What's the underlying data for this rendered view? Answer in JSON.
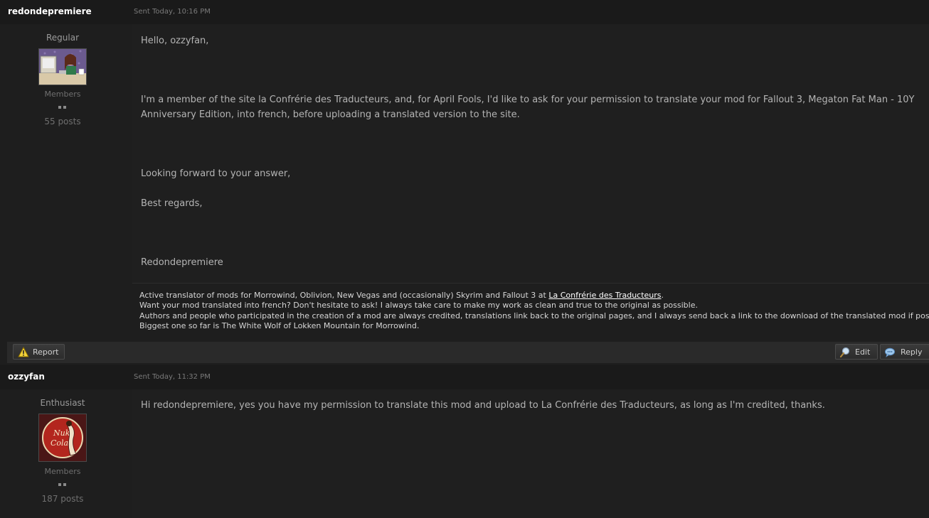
{
  "posts": [
    {
      "author": "redondepremiere",
      "sent": "Sent Today, 10:16 PM",
      "member_title": "Regular",
      "group": "Members",
      "post_count": "55 posts",
      "paragraphs": [
        "Hello, ozzyfan,",
        "I'm a member of the site la Confrérie des Traducteurs, and, for April Fools, I'd like to ask for your permission to translate your mod for Fallout 3, Megaton Fat Man - 10Y",
        "Anniversary Edition, into french, before uploading a translated version to the site.",
        "Looking forward to your answer,",
        "Best regards,",
        "Redondepremiere"
      ],
      "signature": {
        "line1_prefix": "Active translator of mods for Morrowind, Oblivion, New Vegas and (occasionally) Skyrim and Fallout 3 at ",
        "line1_link": "La Confrérie des Traducteurs",
        "line1_suffix": ".",
        "line2": "Want your mod translated into french? Don't hesitate to ask! I always take care to make my work as clean and true to the original as possible.",
        "line3": "Authors and people who participated in the creation of a mod are always credited, translations link back to the original pages, and I always send back a link to the download of the translated mod if possible.",
        "line4": "Biggest one so far is The White Wolf of Lokken Mountain for Morrowind."
      },
      "controls": {
        "report": "Report",
        "edit": "Edit",
        "reply": "Reply"
      }
    },
    {
      "author": "ozzyfan",
      "sent": "Sent Today, 11:32 PM",
      "member_title": "Enthusiast",
      "group": "Members",
      "post_count": "187 posts",
      "paragraphs": [
        "Hi redondepremiere, yes you have my permission to translate this mod and upload to La Confrérie des Traducteurs, as long as I'm credited, thanks."
      ],
      "avatar_text": [
        "Nuka",
        "Cola"
      ]
    }
  ],
  "icons": {
    "report": "warning-icon",
    "edit": "magnifier-pencil-icon",
    "reply": "speech-bubble-icon"
  },
  "colors": {
    "background": "#1c1c1c",
    "header": "#1a1a1a",
    "text": "#b4b4b4",
    "author": "#ffffff"
  }
}
